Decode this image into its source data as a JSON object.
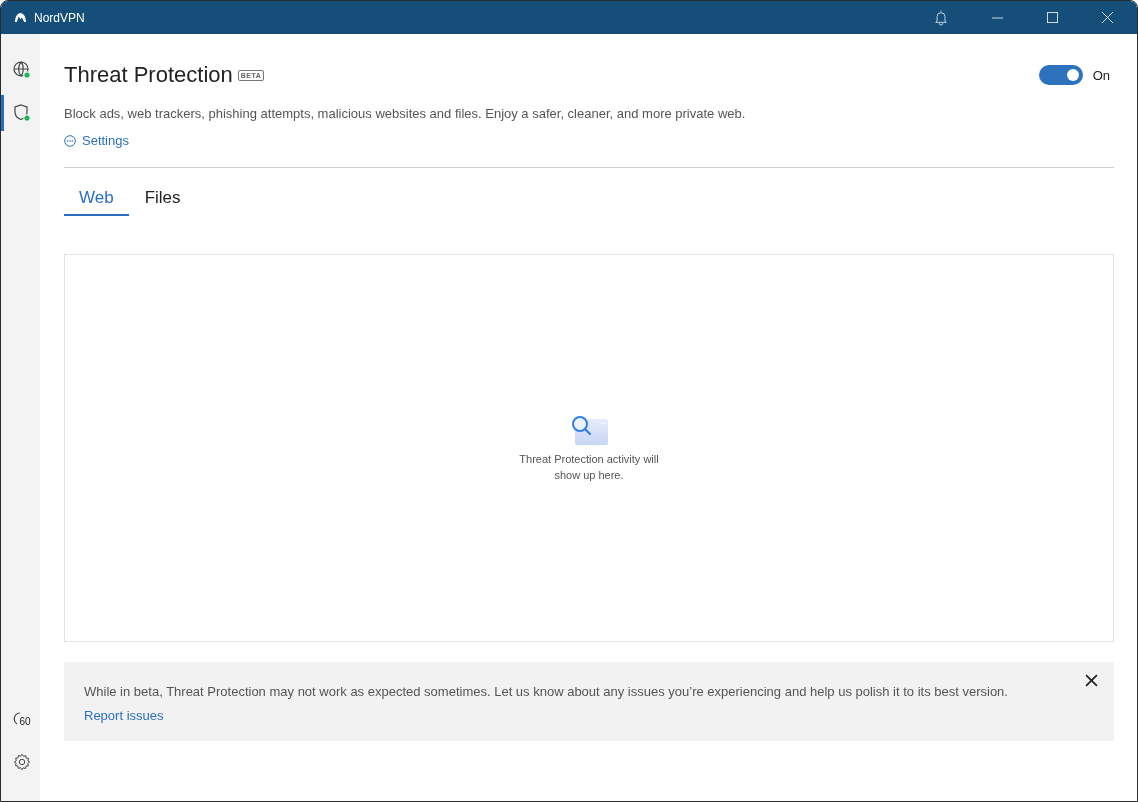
{
  "window": {
    "title": "NordVPN"
  },
  "sidebar": {
    "items": [
      {
        "kind": "globe",
        "selected": false,
        "connected": true
      },
      {
        "kind": "shield",
        "selected": true,
        "connected": true
      }
    ],
    "bottom_items": [
      {
        "kind": "timer",
        "label": "60",
        "selected": false
      },
      {
        "kind": "settings",
        "selected": false
      }
    ]
  },
  "page": {
    "title": "Threat Protection",
    "badge": "BETA",
    "toggle": {
      "on": true,
      "label": "On"
    },
    "description": "Block ads, web trackers, phishing attempts, malicious websites and files. Enjoy a safer, cleaner, and more private web.",
    "settings_link": "Settings"
  },
  "tabs": [
    {
      "label": "Web",
      "selected": true
    },
    {
      "label": "Files",
      "selected": false
    }
  ],
  "empty_state": {
    "message": "Threat Protection activity will show up here."
  },
  "notice": {
    "text": "While in beta, Threat Protection may not work as expected sometimes. Let us know about any issues you’re experiencing and help us polish it to its best version.",
    "link": "Report issues"
  }
}
